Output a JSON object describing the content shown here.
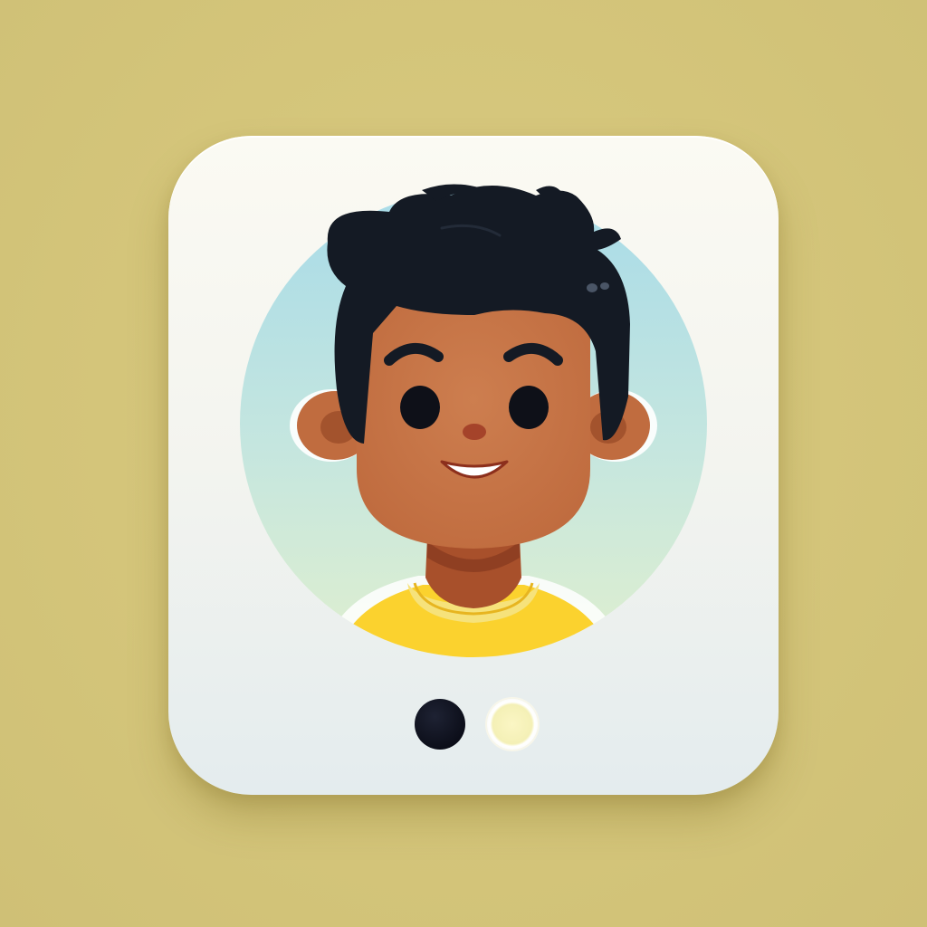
{
  "colors": {
    "background": "#d4c57a",
    "card": "#f7f7f1",
    "skin": "#c9774a",
    "hair": "#141a24",
    "shirt": "#fbd22e",
    "circle_top": "#a9dbe6",
    "circle_bottom": "#d9ecd2",
    "dot_active": "#0b0d18",
    "dot_inactive": "#f7f2bf"
  },
  "icons": {
    "avatar": "boy-avatar-icon"
  },
  "pager": {
    "count": 2,
    "active_index": 0
  }
}
